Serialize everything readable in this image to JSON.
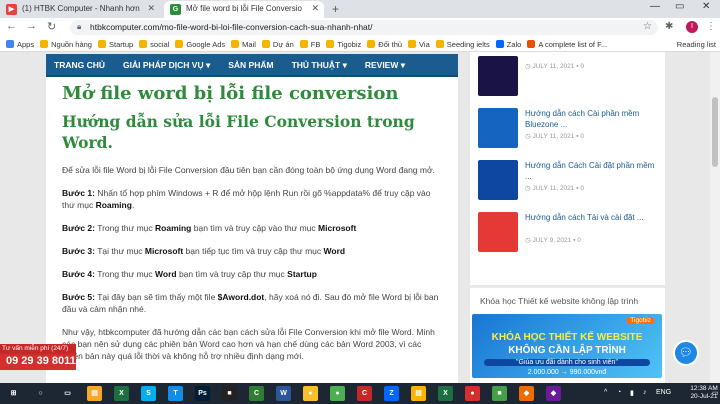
{
  "browser": {
    "tabs": [
      {
        "label": "(1) HTBK Computer - Nhanh hơn",
        "active": false
      },
      {
        "label": "Mở file word bị lỗi File Conversio",
        "active": true
      }
    ],
    "url": "htbkcomputer.com/mo-file-word-bi-loi-file-conversion-cach-sua-nhanh-nhat/",
    "profile_initial": "I",
    "bookmarks": [
      {
        "label": "Apps",
        "color": "#4285f4"
      },
      {
        "label": "Nguồn hàng",
        "color": "#f4b400"
      },
      {
        "label": "Startup",
        "color": "#f4b400"
      },
      {
        "label": "social",
        "color": "#f4b400"
      },
      {
        "label": "Google Ads",
        "color": "#f4b400"
      },
      {
        "label": "Mail",
        "color": "#f4b400"
      },
      {
        "label": "Dự án",
        "color": "#f4b400"
      },
      {
        "label": "FB",
        "color": "#f4b400"
      },
      {
        "label": "Tigobiz",
        "color": "#f4b400"
      },
      {
        "label": "Đối thủ",
        "color": "#f4b400"
      },
      {
        "label": "Via",
        "color": "#f4b400"
      },
      {
        "label": "Seeding ielts",
        "color": "#f4b400"
      },
      {
        "label": "Zalo",
        "color": "#0068ff"
      },
      {
        "label": "A complete list of F...",
        "color": "#e65100"
      }
    ],
    "reading_list": "Reading list"
  },
  "site_nav": [
    "TRANG CHỦ",
    "GIẢI PHÁP DỊCH VỤ ▾",
    "SẢN PHẨM",
    "THỦ THUẬT ▾",
    "REVIEW ▾"
  ],
  "article": {
    "title": "Mở file word bị lỗi file conversion",
    "subtitle": "Hướng dẫn sửa lỗi File Conversion trong Word.",
    "intro": "Để sửa lỗi file Word bị lỗi File Conversion đầu tiên bạn cần đóng toàn bộ ứng dụng Word đang mở.",
    "steps": [
      {
        "label": "Bước 1:",
        "pre": " Nhấn tổ hợp phím   Windows + R   để mở hộp lệnh Run rồi gõ   %appdata%   để truy cập vào thư mục ",
        "bold": "Roaming",
        "post": "."
      },
      {
        "label": "Bước 2:",
        "pre": " Trong thư mục ",
        "bold": "Roaming",
        "post": " bạn tìm và truy cập vào thư mục ",
        "bold2": "Microsoft"
      },
      {
        "label": "Bước 3:",
        "pre": " Tại thư mục ",
        "bold": "Microsoft",
        "post": " bạn tiếp tục tìm và truy cập thư mục ",
        "bold2": "Word"
      },
      {
        "label": "Bước 4:",
        "pre": " Trong thư mục ",
        "bold": "Word",
        "post": " bạn tìm và truy cập thư mục ",
        "bold2": "Startup"
      },
      {
        "label": "Bước 5:",
        "pre": " Tại đây bạn sẽ tìm thấy một file ",
        "bold": "$Aword.dot",
        "post": ", hãy xoá nó đi. Sau đó mở file Word bị lỗi ban đầu và cảm nhận nhé."
      }
    ],
    "conclusion": "Như vậy, htbkcomputer đã hướng dẫn các bạn cách sửa lỗi File Conversion khi mở file Word. Minh các bạn nên sử dụng các phiên bản Word cao hơn và hạn chế dùng các bản Word 2003, vì các phiên bản này quá lỗi thời và không hỗ trợ nhiều định dạng mới."
  },
  "sidebar": {
    "posts": [
      {
        "title": "",
        "date": "JULY 11, 2021",
        "comments": "0",
        "thumb_color": "#1a1446"
      },
      {
        "title": "Hướng dẫn cách Cài phần mềm Bluezone ...",
        "date": "JULY 11, 2021",
        "comments": "0",
        "thumb_color": "#1565c0"
      },
      {
        "title": "Hướng dẫn Cách Cài đặt phần mềm ...",
        "date": "JULY 11, 2021",
        "comments": "0",
        "thumb_color": "#0d47a1"
      },
      {
        "title": "Hướng dẫn cách Tải và cài đặt ...",
        "date": "JULY 9, 2021",
        "comments": "0",
        "thumb_color": "#e53935"
      }
    ],
    "course_heading": "Khóa học Thiết kế website không lập trình",
    "banner": {
      "brand": "Tigobiz",
      "line1": "KHÓA HỌC THIẾT KẾ WEBSITE",
      "line2": "KHÔNG CẦN LẬP TRÌNH",
      "line3": "\"Giúa ưu đãi dành cho sinh viên\"",
      "line4": "2.000.000 → 990.000vnđ"
    }
  },
  "hotline": {
    "label": "Tư vấn miễn phí (24/7)",
    "number": "09 29 39 8011"
  },
  "taskbar": {
    "apps": [
      {
        "icon": "windows-start",
        "color": "#1c2733",
        "glyph": "⊞"
      },
      {
        "icon": "search",
        "color": "#1c2733",
        "glyph": "○"
      },
      {
        "icon": "task-view",
        "color": "#1c2733",
        "glyph": "▭"
      },
      {
        "icon": "file-explorer",
        "color": "#f9a825",
        "glyph": "▤"
      },
      {
        "icon": "excel",
        "color": "#1d6f42",
        "glyph": "X"
      },
      {
        "icon": "skype",
        "color": "#00aff0",
        "glyph": "S"
      },
      {
        "icon": "teamviewer",
        "color": "#0e8ee9",
        "glyph": "T"
      },
      {
        "icon": "photoshop",
        "color": "#001e36",
        "glyph": "Ps"
      },
      {
        "icon": "app-black",
        "color": "#222222",
        "glyph": "■"
      },
      {
        "icon": "camtasia",
        "color": "#2e7d32",
        "glyph": "C"
      },
      {
        "icon": "word",
        "color": "#2b579a",
        "glyph": "W"
      },
      {
        "icon": "chrome",
        "color": "#fbc02d",
        "glyph": "●"
      },
      {
        "icon": "chrome-2",
        "color": "#4caf50",
        "glyph": "●"
      },
      {
        "icon": "ccleaner",
        "color": "#c62828",
        "glyph": "C"
      },
      {
        "icon": "zalo",
        "color": "#0068ff",
        "glyph": "Z"
      },
      {
        "icon": "folder",
        "color": "#ffb300",
        "glyph": "▤"
      },
      {
        "icon": "excel-2",
        "color": "#1d6f42",
        "glyph": "X"
      },
      {
        "icon": "app-red",
        "color": "#d32f2f",
        "glyph": "●"
      },
      {
        "icon": "app-green",
        "color": "#43a047",
        "glyph": "■"
      },
      {
        "icon": "app-orange",
        "color": "#ef6c00",
        "glyph": "◆"
      },
      {
        "icon": "app-purple",
        "color": "#6a1b9a",
        "glyph": "◆"
      }
    ],
    "lang": "ENG",
    "time": "12:38 AM",
    "date": "20-Jul-21"
  }
}
